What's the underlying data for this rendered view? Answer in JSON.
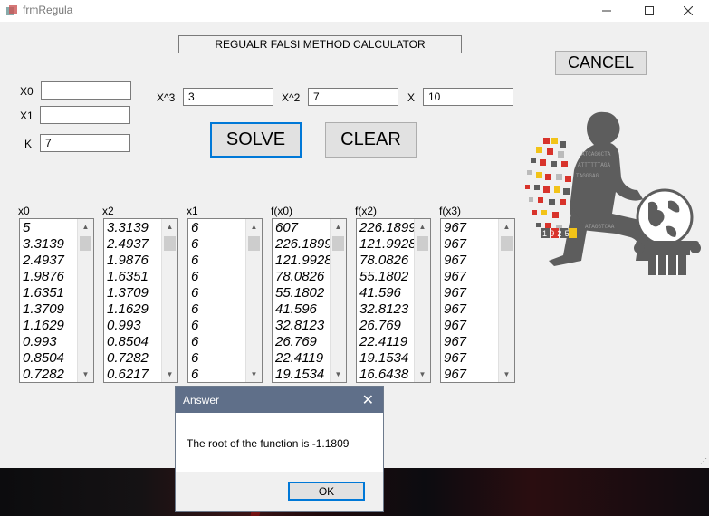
{
  "window": {
    "title": "frmRegula",
    "minimize_icon": "minimize-icon",
    "maximize_icon": "maximize-icon",
    "close_icon": "close-icon"
  },
  "header_label": "REGUALR FALSI METHOD CALCULATOR",
  "buttons": {
    "cancel": "CANCEL",
    "solve": "SOLVE",
    "clear": "CLEAR"
  },
  "inputs": {
    "x0": {
      "label": "X0",
      "value": ""
    },
    "x1": {
      "label": "X1",
      "value": ""
    },
    "k": {
      "label": "K",
      "value": "7"
    },
    "x3": {
      "label": "X^3",
      "value": "3"
    },
    "x2": {
      "label": "X^2",
      "value": "7"
    },
    "x": {
      "label": "X",
      "value": "10"
    }
  },
  "lists": [
    {
      "label": "x0",
      "items": [
        "5",
        "3.3139",
        "2.4937",
        "1.9876",
        "1.6351",
        "1.3709",
        "1.1629",
        "0.993",
        "0.8504",
        "0.7282"
      ]
    },
    {
      "label": "x2",
      "items": [
        "3.3139",
        "2.4937",
        "1.9876",
        "1.6351",
        "1.3709",
        "1.1629",
        "0.993",
        "0.8504",
        "0.7282",
        "0.6217"
      ]
    },
    {
      "label": "x1",
      "items": [
        "6",
        "6",
        "6",
        "6",
        "6",
        "6",
        "6",
        "6",
        "6",
        "6"
      ]
    },
    {
      "label": "f(x0)",
      "items": [
        "607",
        "226.1899",
        "121.9928",
        "78.0826",
        "55.1802",
        "41.596",
        "32.8123",
        "26.769",
        "22.4119",
        "19.1534"
      ]
    },
    {
      "label": "f(x2)",
      "items": [
        "226.1899",
        "121.9928",
        "78.0826",
        "55.1802",
        "41.596",
        "32.8123",
        "26.769",
        "22.4119",
        "19.1534",
        "16.6438"
      ]
    },
    {
      "label": "f(x3)",
      "items": [
        "967",
        "967",
        "967",
        "967",
        "967",
        "967",
        "967",
        "967",
        "967",
        "967"
      ]
    }
  ],
  "logo": {
    "icon": "university-logo-icon",
    "year": "1925",
    "colors": {
      "red": "#d8332b",
      "yellow": "#f2c318",
      "gray": "#5d5d5d"
    }
  },
  "dialog": {
    "title": "Answer",
    "message": "The root of the function is -1.1809",
    "ok": "OK"
  },
  "colors": {
    "accent": "#0078d7",
    "dialog_title_bg": "#5f6f89",
    "window_bg": "#f0f0f0"
  }
}
